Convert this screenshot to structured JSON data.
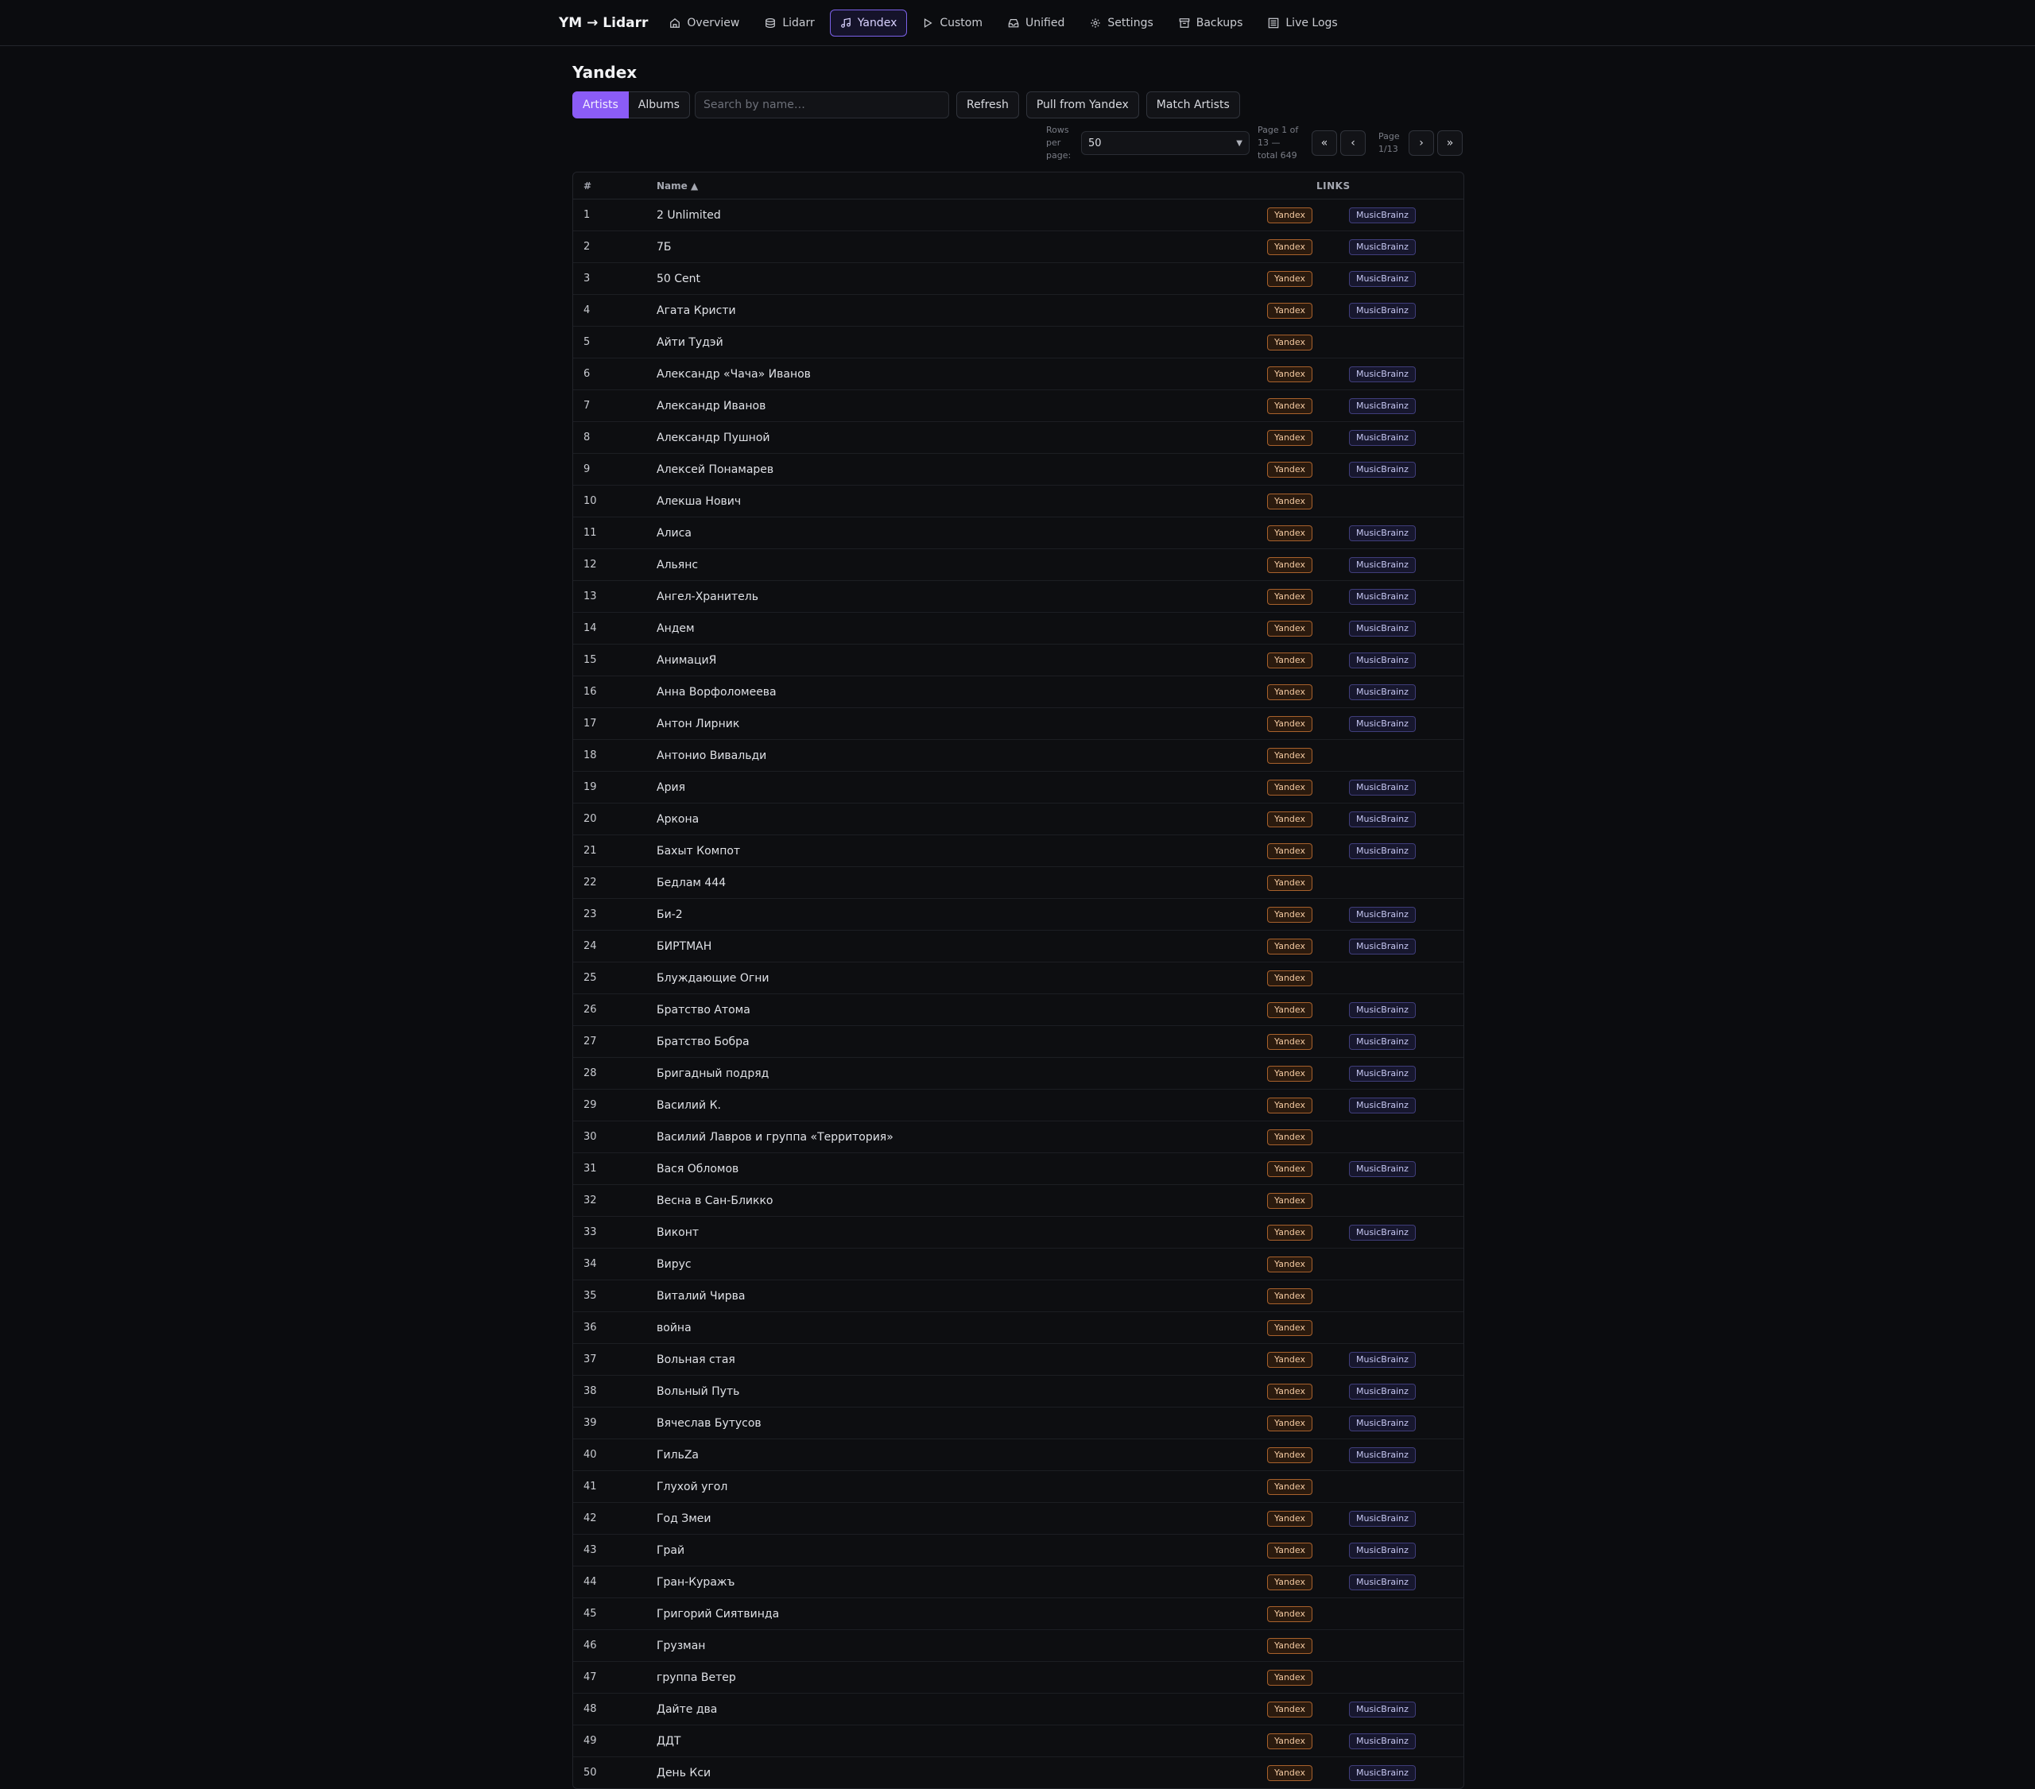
{
  "nav": {
    "brand": "YM → Lidarr",
    "items": [
      {
        "label": "Overview",
        "icon": "home-icon",
        "active": false
      },
      {
        "label": "Lidarr",
        "icon": "database-icon",
        "active": false
      },
      {
        "label": "Yandex",
        "icon": "music-icon",
        "active": true
      },
      {
        "label": "Custom",
        "icon": "play-icon",
        "active": false
      },
      {
        "label": "Unified",
        "icon": "inbox-icon",
        "active": false
      },
      {
        "label": "Settings",
        "icon": "gear-icon",
        "active": false
      },
      {
        "label": "Backups",
        "icon": "archive-icon",
        "active": false
      },
      {
        "label": "Live Logs",
        "icon": "list-icon",
        "active": false
      }
    ]
  },
  "page": {
    "title": "Yandex"
  },
  "toolbar": {
    "tab_artists": "Artists",
    "tab_albums": "Albums",
    "active_tab": "Artists",
    "search_placeholder": "Search by name…",
    "search_value": "",
    "refresh": "Refresh",
    "pull": "Pull from Yandex",
    "match": "Match Artists"
  },
  "pager": {
    "rows_label": "Rows per page:",
    "rows_value": "50",
    "page_info": "Page 1 of 13 — total 649",
    "page_num": "Page 1/13",
    "first": "«",
    "prev": "‹",
    "next": "›",
    "last": "»"
  },
  "table": {
    "columns": {
      "num": "#",
      "name": "Name ▲",
      "links": "LINKS"
    },
    "badge_yandex": "Yandex",
    "badge_mb": "MusicBrainz",
    "rows": [
      {
        "n": "1",
        "name": "2 Unlimited",
        "mb": true
      },
      {
        "n": "2",
        "name": "7Б",
        "mb": true
      },
      {
        "n": "3",
        "name": "50 Cent",
        "mb": true
      },
      {
        "n": "4",
        "name": "Агата Кристи",
        "mb": true
      },
      {
        "n": "5",
        "name": "Айти Тудэй",
        "mb": false
      },
      {
        "n": "6",
        "name": "Александр «Чача» Иванов",
        "mb": true
      },
      {
        "n": "7",
        "name": "Александр Иванов",
        "mb": true
      },
      {
        "n": "8",
        "name": "Александр Пушной",
        "mb": true
      },
      {
        "n": "9",
        "name": "Алексей Понамарев",
        "mb": true
      },
      {
        "n": "10",
        "name": "Алекша Нович",
        "mb": false
      },
      {
        "n": "11",
        "name": "Алиса",
        "mb": true
      },
      {
        "n": "12",
        "name": "Альянс",
        "mb": true
      },
      {
        "n": "13",
        "name": "Ангел-Хранитель",
        "mb": true
      },
      {
        "n": "14",
        "name": "Андем",
        "mb": true
      },
      {
        "n": "15",
        "name": "АнимациЯ",
        "mb": true
      },
      {
        "n": "16",
        "name": "Анна Ворфоломеева",
        "mb": true
      },
      {
        "n": "17",
        "name": "Антон Лирник",
        "mb": true
      },
      {
        "n": "18",
        "name": "Антонио Вивальди",
        "mb": false
      },
      {
        "n": "19",
        "name": "Ария",
        "mb": true
      },
      {
        "n": "20",
        "name": "Аркона",
        "mb": true
      },
      {
        "n": "21",
        "name": "Бахыт Компот",
        "mb": true
      },
      {
        "n": "22",
        "name": "Бедлам 444",
        "mb": false
      },
      {
        "n": "23",
        "name": "Би-2",
        "mb": true
      },
      {
        "n": "24",
        "name": "БИРТМАН",
        "mb": true
      },
      {
        "n": "25",
        "name": "Блуждающие Огни",
        "mb": false
      },
      {
        "n": "26",
        "name": "Братство Атома",
        "mb": true
      },
      {
        "n": "27",
        "name": "Братство Бобра",
        "mb": true
      },
      {
        "n": "28",
        "name": "Бригадный подряд",
        "mb": true
      },
      {
        "n": "29",
        "name": "Василий К.",
        "mb": true
      },
      {
        "n": "30",
        "name": "Василий Лавров и группа «Территория»",
        "mb": false
      },
      {
        "n": "31",
        "name": "Вася Обломов",
        "mb": true
      },
      {
        "n": "32",
        "name": "Весна в Сан-Бликко",
        "mb": false
      },
      {
        "n": "33",
        "name": "Виконт",
        "mb": true
      },
      {
        "n": "34",
        "name": "Вирус",
        "mb": false
      },
      {
        "n": "35",
        "name": "Виталий Чирва",
        "mb": false
      },
      {
        "n": "36",
        "name": "война",
        "mb": false
      },
      {
        "n": "37",
        "name": "Вольная стая",
        "mb": true
      },
      {
        "n": "38",
        "name": "Вольный Путь",
        "mb": true
      },
      {
        "n": "39",
        "name": "Вячеслав Бутусов",
        "mb": true
      },
      {
        "n": "40",
        "name": "ГильZа",
        "mb": true
      },
      {
        "n": "41",
        "name": "Глухой угол",
        "mb": false
      },
      {
        "n": "42",
        "name": "Год Змеи",
        "mb": true
      },
      {
        "n": "43",
        "name": "Грай",
        "mb": true
      },
      {
        "n": "44",
        "name": "Гран-Куражъ",
        "mb": true
      },
      {
        "n": "45",
        "name": "Григорий Сиятвинда",
        "mb": false
      },
      {
        "n": "46",
        "name": "Грузман",
        "mb": false
      },
      {
        "n": "47",
        "name": "группа Ветер",
        "mb": false
      },
      {
        "n": "48",
        "name": "Дайте два",
        "mb": true
      },
      {
        "n": "49",
        "name": "ДДТ",
        "mb": true
      },
      {
        "n": "50",
        "name": "День Кси",
        "mb": true
      }
    ]
  }
}
